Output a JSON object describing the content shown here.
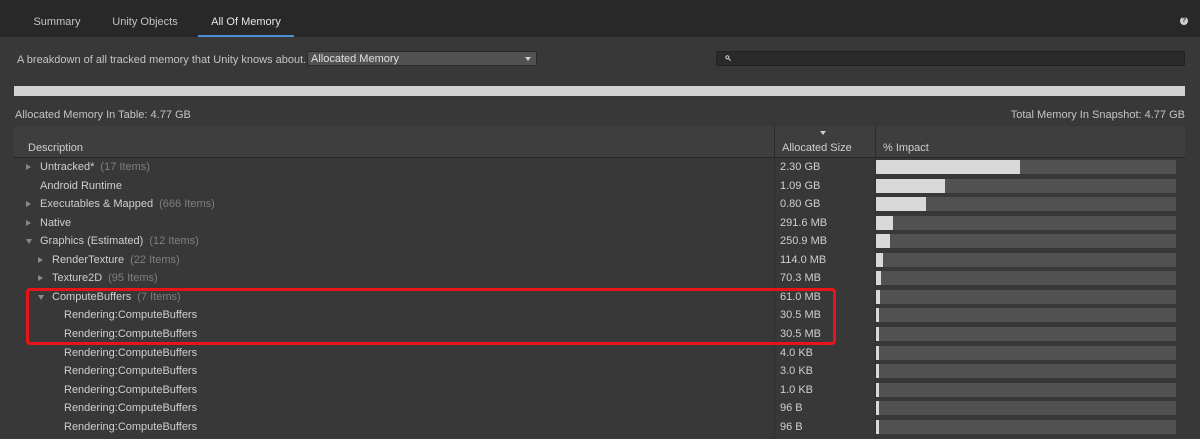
{
  "tabs": [
    {
      "label": "Summary",
      "active": false
    },
    {
      "label": "Unity Objects",
      "active": false
    },
    {
      "label": "All Of Memory",
      "active": true
    }
  ],
  "toolbar": {
    "description": "A breakdown of all tracked memory that Unity knows about.",
    "dropdown_value": "Allocated Memory",
    "search_value": ""
  },
  "icons": {
    "help": "help-icon",
    "search": "search-icon",
    "dropdown": "chevron-down-icon"
  },
  "summary": {
    "allocated_in_table": "Allocated Memory In Table: 4.77 GB",
    "total_in_snapshot": "Total Memory In Snapshot: 4.77 GB"
  },
  "table": {
    "headers": {
      "description": "Description",
      "allocated_size": "Allocated Size",
      "impact": "% Impact"
    },
    "rows": [
      {
        "name": "Untracked*",
        "count": "(17 Items)",
        "size": "2.30 GB",
        "impact": 0.48,
        "level": 0,
        "toggle": "closed"
      },
      {
        "name": "Android Runtime",
        "count": "",
        "size": "1.09 GB",
        "impact": 0.23,
        "level": 0,
        "toggle": "none"
      },
      {
        "name": "Executables & Mapped",
        "count": "(666 Items)",
        "size": "0.80 GB",
        "impact": 0.167,
        "level": 0,
        "toggle": "closed"
      },
      {
        "name": "Native",
        "count": "",
        "size": "291.6 MB",
        "impact": 0.058,
        "level": 0,
        "toggle": "closed"
      },
      {
        "name": "Graphics (Estimated)",
        "count": "(12 Items)",
        "size": "250.9 MB",
        "impact": 0.048,
        "level": 0,
        "toggle": "open"
      },
      {
        "name": "RenderTexture",
        "count": "(22 Items)",
        "size": "114.0 MB",
        "impact": 0.022,
        "level": 1,
        "toggle": "closed"
      },
      {
        "name": "Texture2D",
        "count": "(95 Items)",
        "size": "70.3 MB",
        "impact": 0.015,
        "level": 1,
        "toggle": "closed"
      },
      {
        "name": "ComputeBuffers",
        "count": "(7 Items)",
        "size": "61.0 MB",
        "impact": 0.013,
        "level": 1,
        "toggle": "open"
      },
      {
        "name": "Rendering:ComputeBuffers",
        "count": "",
        "size": "30.5 MB",
        "impact": 0.007,
        "level": 2,
        "toggle": "none"
      },
      {
        "name": "Rendering:ComputeBuffers",
        "count": "",
        "size": "30.5 MB",
        "impact": 0.007,
        "level": 2,
        "toggle": "none"
      },
      {
        "name": "Rendering:ComputeBuffers",
        "count": "",
        "size": "4.0 KB",
        "impact": 0.004,
        "level": 2,
        "toggle": "none"
      },
      {
        "name": "Rendering:ComputeBuffers",
        "count": "",
        "size": "3.0 KB",
        "impact": 0.004,
        "level": 2,
        "toggle": "none"
      },
      {
        "name": "Rendering:ComputeBuffers",
        "count": "",
        "size": "1.0 KB",
        "impact": 0.004,
        "level": 2,
        "toggle": "none"
      },
      {
        "name": "Rendering:ComputeBuffers",
        "count": "",
        "size": "96 B",
        "impact": 0.004,
        "level": 2,
        "toggle": "none"
      },
      {
        "name": "Rendering:ComputeBuffers",
        "count": "",
        "size": "96 B",
        "impact": 0.004,
        "level": 2,
        "toggle": "none"
      }
    ]
  },
  "colors": {
    "accent": "#4c8fd6",
    "highlight": "#e8141a",
    "impact_fill": "#d9d9d9"
  }
}
